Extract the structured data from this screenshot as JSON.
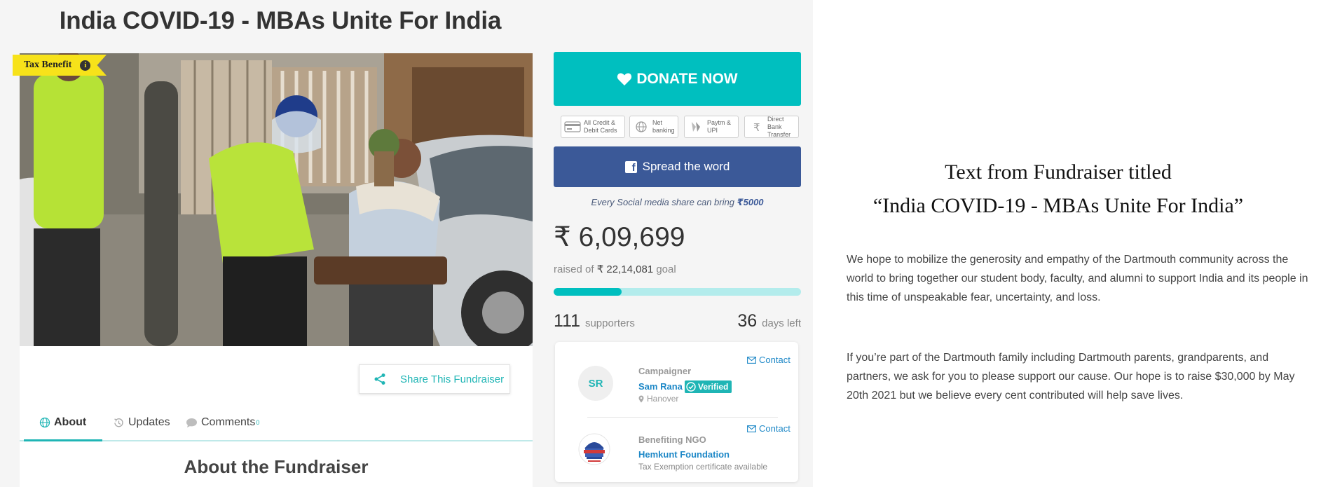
{
  "page": {
    "title": "India COVID-19 - MBAs Unite For India"
  },
  "media": {
    "tax_badge": "Tax Benefit",
    "info_glyph": "i"
  },
  "share": {
    "label": "Share This Fundraiser"
  },
  "tabs": [
    {
      "label": "About",
      "active": true,
      "icon": "globe-icon"
    },
    {
      "label": "Updates",
      "active": false,
      "icon": "history-icon"
    },
    {
      "label": "Comments",
      "count": "0",
      "active": false,
      "icon": "comment-icon"
    }
  ],
  "about_heading": "About the Fundraiser",
  "donate": {
    "label": "DONATE NOW"
  },
  "payment_options": [
    {
      "line1": "All Credit &",
      "line2": "Debit Cards",
      "icon": "card-icon"
    },
    {
      "line1": "Net",
      "line2": "banking",
      "icon": "globe-icon"
    },
    {
      "line1": "Paytm &",
      "line2": "UPI",
      "icon": "upi-icon"
    },
    {
      "line1": "Direct Bank",
      "line2": "Transfer",
      "icon": "rupee-icon"
    }
  ],
  "spread": {
    "label": "Spread the word",
    "fb_glyph": "f"
  },
  "social_note": {
    "text": "Every Social media share can bring ",
    "amount": "₹5000"
  },
  "stats": {
    "raised": "₹ 6,09,699",
    "goal_prefix": "raised of",
    "goal_amount": "₹ 22,14,081",
    "goal_suffix": "goal",
    "progress_fraction": 0.275,
    "supporters_count": "111",
    "supporters_label": "supporters",
    "days_count": "36",
    "days_label": "days left"
  },
  "campaigner": {
    "role": "Campaigner",
    "initials": "SR",
    "name": "Sam Rana",
    "verified": "Verified",
    "location": "Hanover",
    "contact": "Contact"
  },
  "ngo": {
    "role": "Benefiting NGO",
    "name": "Hemkunt Foundation",
    "note": "Tax Exemption certificate available",
    "contact": "Contact"
  },
  "right_panel": {
    "title_line1": "Text from Fundraiser titled",
    "title_line2": "“India COVID-19 - MBAs Unite For India”",
    "paragraph1": "We hope to mobilize the generosity and empathy of the Dartmouth community across the world to bring together our student body, faculty, and alumni to support India and its people in this time of unspeakable fear, uncertainty, and loss.",
    "paragraph2": "If you’re part of the Dartmouth family including Dartmouth parents, grandparents, and partners, we ask for you to please support our cause. Our hope is to raise $30,000 by May 20th 2021 but we believe every cent contributed will help save lives."
  },
  "colors": {
    "accent": "#00bfbf",
    "facebook": "#3b5998",
    "link": "#1e88c7",
    "badge": "#f7e21a"
  }
}
